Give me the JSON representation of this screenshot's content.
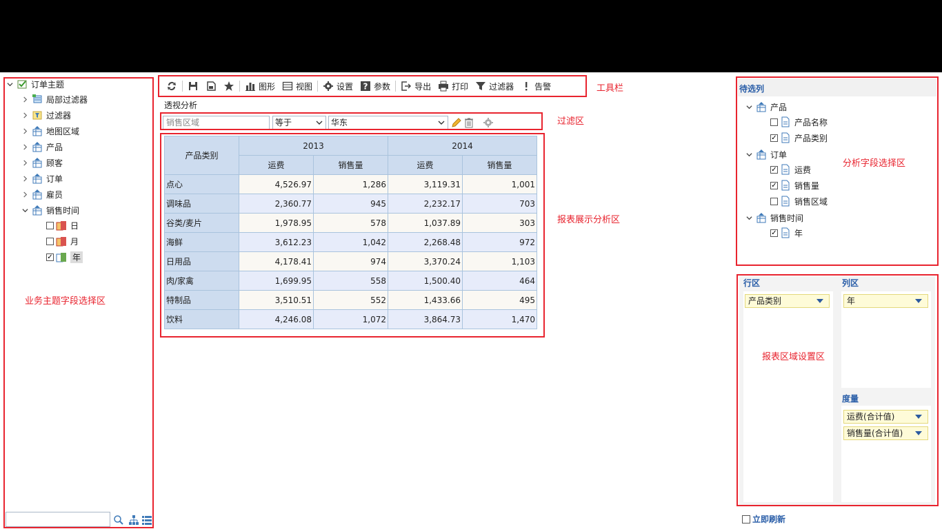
{
  "toolbar": {
    "chart_label": "图形",
    "view_label": "视图",
    "settings_label": "设置",
    "params_label": "参数",
    "export_label": "导出",
    "print_label": "打印",
    "filter_label": "过滤器",
    "alert_label": "告警"
  },
  "view_title": "透视分析",
  "tree": {
    "root": "订单主题",
    "items": [
      "局部过滤器",
      "过滤器",
      "地图区域",
      "产品",
      "顾客",
      "订单",
      "雇员",
      "销售时间"
    ],
    "time_children": [
      {
        "label": "日",
        "checked": false
      },
      {
        "label": "月",
        "checked": false
      },
      {
        "label": "年",
        "checked": true
      }
    ]
  },
  "filter": {
    "field_placeholder": "销售区域",
    "operator": "等于",
    "value": "华东"
  },
  "pivot": {
    "row_header": "产品类别",
    "years": [
      "2013",
      "2014"
    ],
    "measures": [
      "运费",
      "销售量"
    ],
    "rows": [
      {
        "category": "点心",
        "v": [
          "4,526.97",
          "1,286",
          "3,119.31",
          "1,001"
        ]
      },
      {
        "category": "调味品",
        "v": [
          "2,360.77",
          "945",
          "2,232.17",
          "703"
        ]
      },
      {
        "category": "谷类/麦片",
        "v": [
          "1,978.95",
          "578",
          "1,037.89",
          "303"
        ]
      },
      {
        "category": "海鲜",
        "v": [
          "3,612.23",
          "1,042",
          "2,268.48",
          "972"
        ]
      },
      {
        "category": "日用品",
        "v": [
          "4,178.41",
          "974",
          "3,370.24",
          "1,103"
        ]
      },
      {
        "category": "肉/家禽",
        "v": [
          "1,699.95",
          "558",
          "1,500.40",
          "464"
        ]
      },
      {
        "category": "特制品",
        "v": [
          "3,510.51",
          "552",
          "1,433.66",
          "495"
        ]
      },
      {
        "category": "饮料",
        "v": [
          "4,246.08",
          "1,072",
          "3,864.73",
          "1,470"
        ]
      }
    ]
  },
  "pending": {
    "title": "待选列",
    "product": "产品",
    "product_name": "产品名称",
    "product_category": "产品类别",
    "order": "订单",
    "freight": "运费",
    "sales_qty": "销售量",
    "sales_region": "销售区域",
    "sales_time": "销售时间",
    "year": "年"
  },
  "areas": {
    "row_title": "行区",
    "col_title": "列区",
    "measure_title": "度量",
    "row_field": "产品类别",
    "col_field": "年",
    "measure_1": "运费(合计值)",
    "measure_2": "销售量(合计值)",
    "refresh_label": "立即刷新"
  },
  "annotations": {
    "toolbar": "工具栏",
    "filter": "过滤区",
    "report": "报表展示分析区",
    "fields": "分析字段选择区",
    "business": "业务主题字段选择区",
    "settings": "报表区域设置区"
  }
}
